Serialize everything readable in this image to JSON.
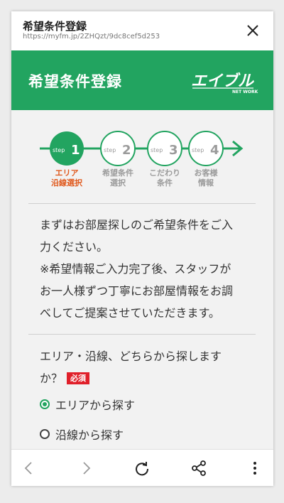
{
  "browser": {
    "title": "希望条件登録",
    "url": "https://myfm.jp/2ZHQzt/9dc8cef5d253"
  },
  "header": {
    "title": "希望条件登録",
    "logo_text": "エイブル",
    "logo_subtext": "NET WORK"
  },
  "steps": [
    {
      "num": "1",
      "prefix": "step",
      "line1": "エリア",
      "line2": "沿線選択",
      "active": true
    },
    {
      "num": "2",
      "prefix": "step",
      "line1": "希望条件",
      "line2": "選択",
      "active": false
    },
    {
      "num": "3",
      "prefix": "step",
      "line1": "こだわり",
      "line2": "条件",
      "active": false
    },
    {
      "num": "4",
      "prefix": "step",
      "line1": "お客様",
      "line2": "情報",
      "active": false
    }
  ],
  "intro": {
    "line1": "まずはお部屋探しのご希望条件をご入",
    "line2": "力ください。",
    "line3": "※希望情報ご入力完了後、スタッフが",
    "line4": "お一人様ずつ丁寧にお部屋情報をお調",
    "line5": "べしてご提案させていただきます。"
  },
  "question": {
    "line1": "エリア・沿線、どちらから探します",
    "line2": "か？",
    "required": "必須"
  },
  "options": [
    {
      "label": "エリアから探す",
      "checked": true
    },
    {
      "label": "沿線から探す",
      "checked": false
    },
    {
      "label": "",
      "checked": false
    }
  ],
  "colors": {
    "brand_green": "#22a460",
    "active_step_label": "#e05a1e",
    "inactive_step": "#9b9b9b",
    "required_red": "#e0202a"
  },
  "icons": [
    "close-icon",
    "back-icon",
    "forward-icon",
    "reload-icon",
    "share-icon",
    "more-icon"
  ]
}
